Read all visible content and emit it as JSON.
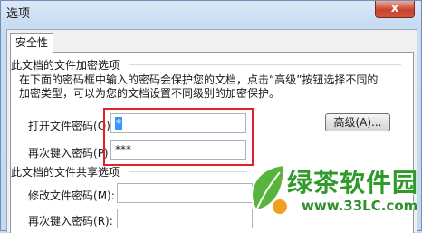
{
  "window": {
    "title": "选项",
    "close_label": "x"
  },
  "tabs": [
    {
      "label": "安全性"
    }
  ],
  "encryption": {
    "group_label": "此文档的文件加密选项",
    "description": "在下面的密码框中输入的密码会保护您的文档，点击“高级”按钮选择不同的加密类型，可以为您的文档设置不同级别的加密保护。",
    "open_password_label": "打开文件密码",
    "open_password_hotkey": "(O)",
    "open_password_value": "*",
    "reenter_label": "再次键入密码",
    "reenter_hotkey": "(P)",
    "reenter_value": "***",
    "advanced_button": "高级(A)..."
  },
  "sharing": {
    "group_label": "此文档的文件共享选项",
    "modify_password_label": "修改文件密码",
    "modify_password_hotkey": "(M)",
    "modify_password_value": "",
    "reenter_label": "再次键入密码",
    "reenter_hotkey": "(R)",
    "reenter_value": ""
  },
  "watermark": {
    "brand": "绿茶软件园",
    "url": "www.33LC.com"
  },
  "colors": {
    "highlight_box": "#e2202a",
    "selection": "#3399ff",
    "watermark_green": "#2f9a2a"
  }
}
